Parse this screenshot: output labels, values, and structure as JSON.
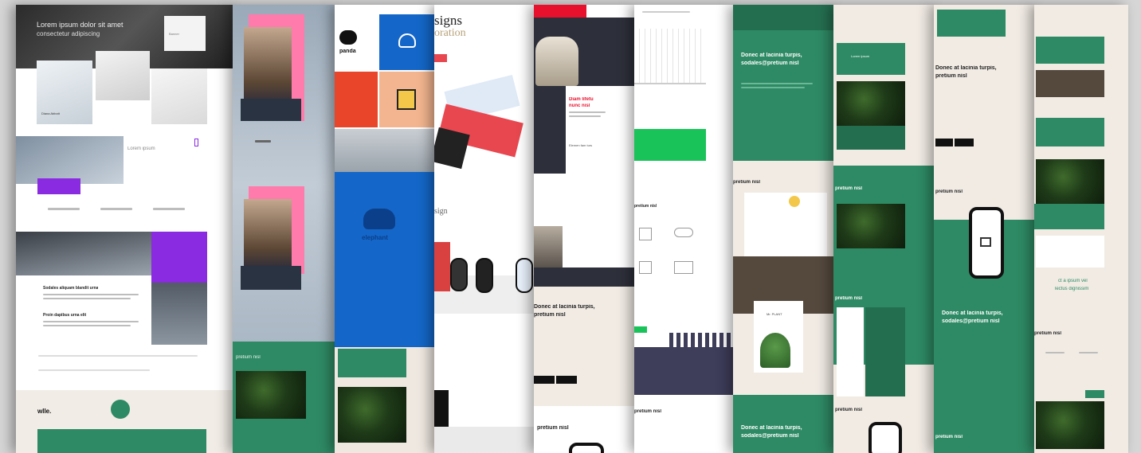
{
  "scene": {
    "description_label": ""
  },
  "strips": {
    "s1": {
      "hero_line1": "Lorem ipsum dolor sit amet",
      "hero_line2": "consectetur adipiscing",
      "card_label": "Banner",
      "name_label": "Diana Abbott",
      "side_caption": "Lorem ipsum",
      "heading1": "Sodales aliquam blandit urna",
      "heading2": "Proin dapibus urna elit",
      "logo": "wlle.",
      "accent": "#8a2be2"
    },
    "s2": {
      "section": "pretium nisl",
      "accent": "#ff7bac"
    },
    "s3": {
      "logo_top": "panda",
      "logo_mid": "elephant",
      "accent": "#1467c8"
    },
    "s4": {
      "heading_top": "signs",
      "heading_sub": "oration",
      "heading_mid": "sign",
      "accent": "#e8474f"
    },
    "s5": {
      "red_head": "Diam lifetu",
      "red_sub": "nunc nisl",
      "section_a": "Elemen fam turs",
      "cream_head": "Donec at lacinia turpis,",
      "cream_sub": "pretium nisl",
      "footer_head": "pretium nisl",
      "accent": "#e8112d"
    },
    "s6": {
      "section": "pretium nisl",
      "accent": "#19c35a"
    },
    "s7": {
      "green_head": "Donec at lacinia turpis,",
      "green_sub": "sodales@pretium nisl",
      "section": "pretium nisl",
      "book_title": "Mr. PLANT",
      "bottom_head": "Donec at lacinia turpis,",
      "bottom_sub": "sodales@pretium nisl"
    },
    "s8": {
      "card_title": "Lorem ipsum",
      "section_a": "pretium nisl",
      "section_b": "pretium nisl",
      "section_c": "pretium nisl"
    },
    "s9": {
      "head": "Donec at lacinia turpis,",
      "sub": "pretium nisl",
      "section": "pretium nisl",
      "green_head": "Donec at lacinia turpis,",
      "green_sub": "sodales@pretium nisl",
      "bottom": "pretium nisl"
    },
    "s10": {
      "quote_a": "ct a ipsum vel",
      "quote_b": "lectus dignissim",
      "section": "pretium nisl"
    }
  }
}
